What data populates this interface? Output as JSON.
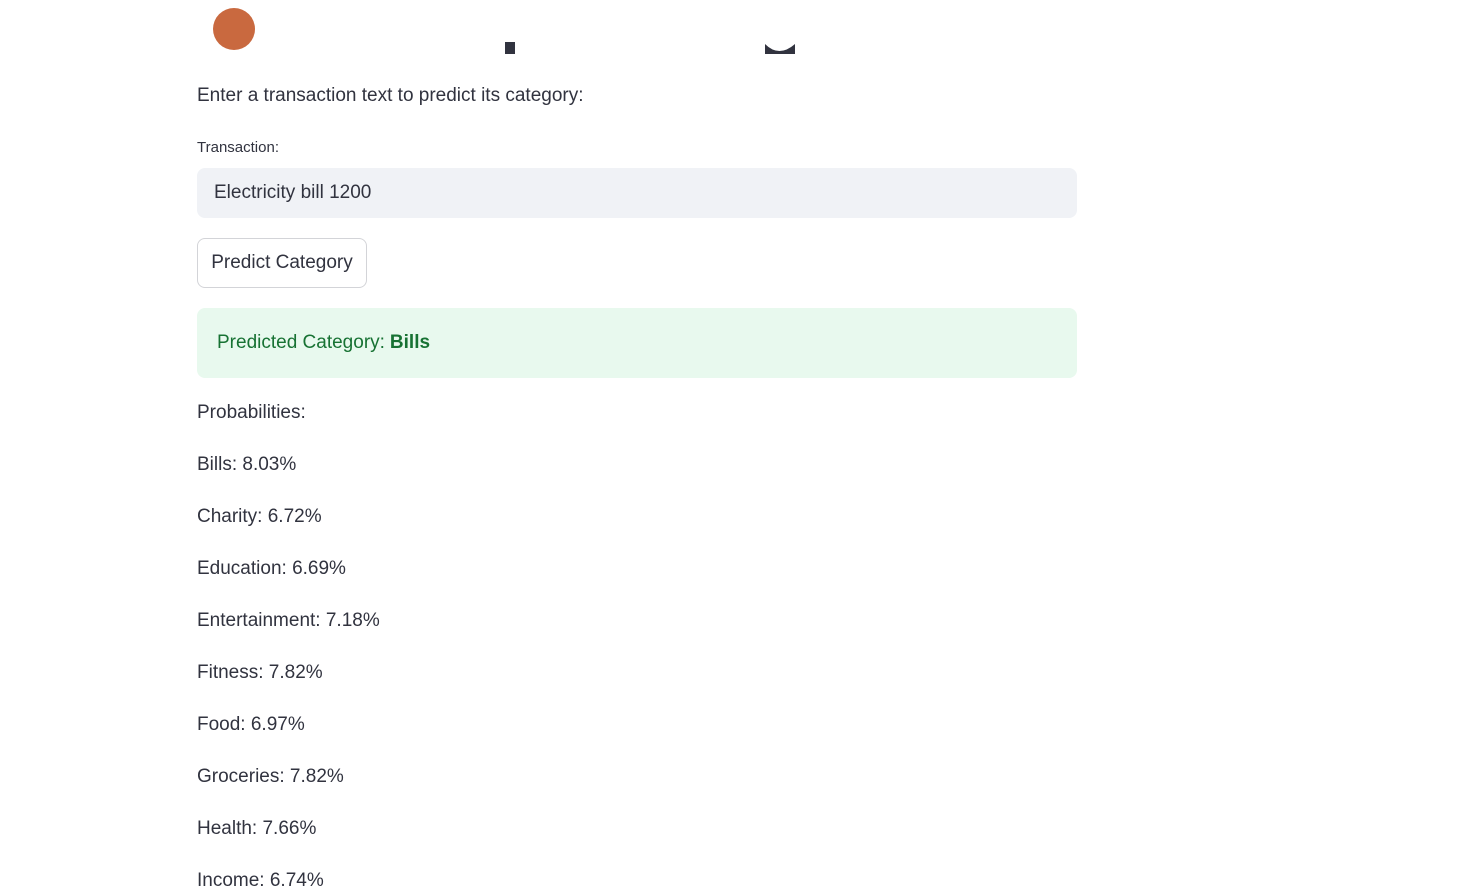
{
  "subtitle": "Enter a transaction text to predict its category:",
  "transaction_input": {
    "label": "Transaction:",
    "value": "Electricity bill 1200"
  },
  "predict_button": {
    "label": "Predict Category"
  },
  "result": {
    "prefix": "Predicted Category:",
    "category": "Bills"
  },
  "probabilities": {
    "heading": "Probabilities:",
    "items": [
      "Bills: 8.03%",
      "Charity: 6.72%",
      "Education: 6.69%",
      "Entertainment: 7.18%",
      "Fitness: 7.82%",
      "Food: 6.97%",
      "Groceries: 7.82%",
      "Health: 7.66%",
      "Income: 6.74%"
    ]
  },
  "colors": {
    "text": "#31333f",
    "input_bg": "#f0f2f6",
    "success_bg": "#e8f9ee",
    "success_text": "#177233",
    "emoji_accent": "#c9693f"
  }
}
